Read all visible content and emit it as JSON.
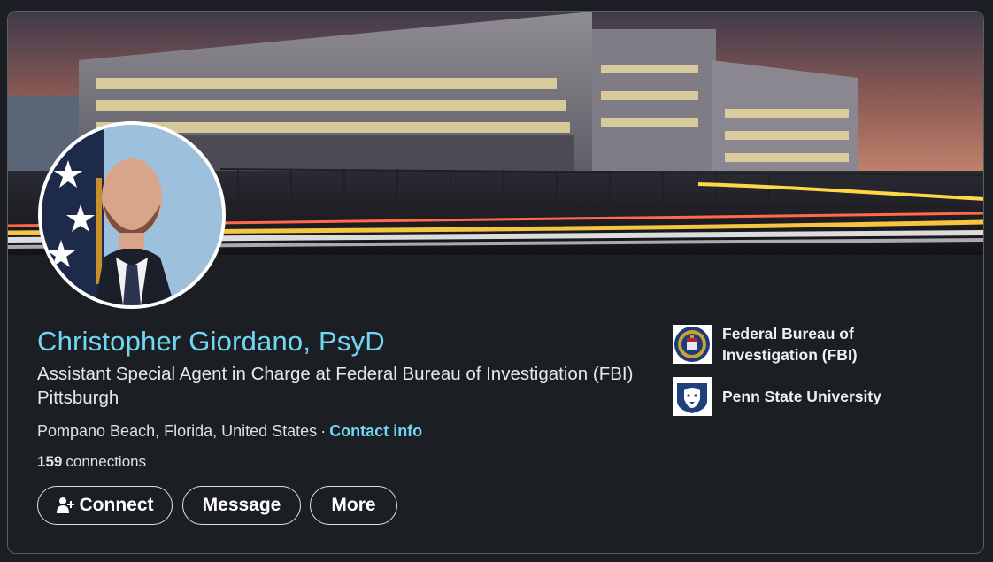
{
  "profile": {
    "name": "Christopher Giordano, PsyD",
    "headline": "Assistant Special Agent in Charge at Federal Bureau of Investigation (FBI) Pittsburgh",
    "location": "Pompano Beach, Florida, United States",
    "separator": "·",
    "contact_info": "Contact info",
    "connections_count": "159",
    "connections_label": "connections"
  },
  "actions": {
    "connect": "Connect",
    "message": "Message",
    "more": "More"
  },
  "organizations": [
    {
      "name": "Federal Bureau of Investigation (FBI)",
      "logo": "fbi-seal-icon"
    },
    {
      "name": "Penn State University",
      "logo": "nittany-lion-icon"
    }
  ],
  "colors": {
    "accent": "#71d7f2",
    "background": "#1b1f23",
    "button_border": "#e0e0e0"
  },
  "icons": [
    "add-person-icon"
  ]
}
